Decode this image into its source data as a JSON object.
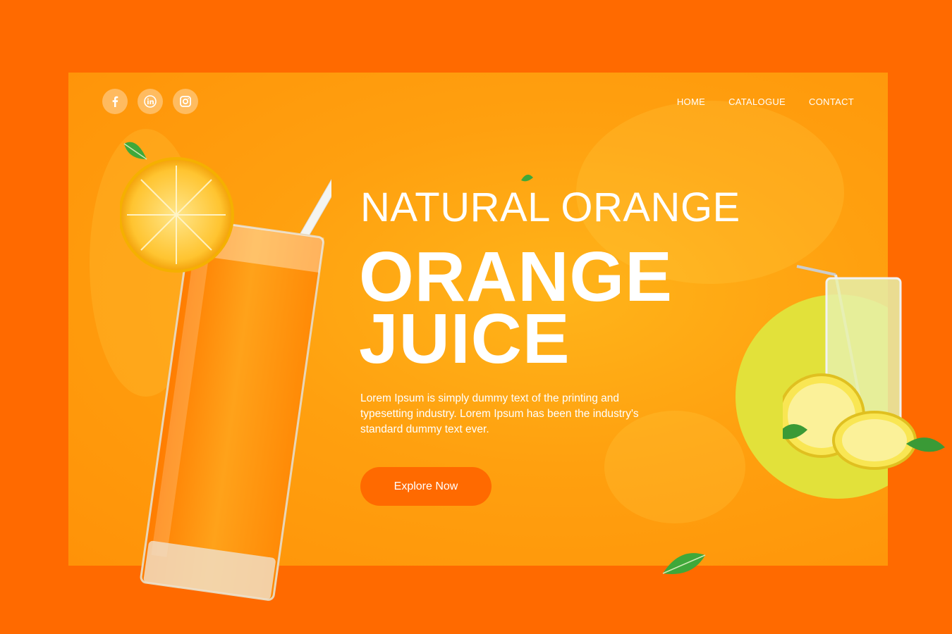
{
  "social": {
    "items": [
      {
        "name": "facebook",
        "glyph": "f"
      },
      {
        "name": "linkedin",
        "glyph": "in"
      },
      {
        "name": "instagram",
        "glyph": "◎"
      }
    ]
  },
  "nav": {
    "home": "HOME",
    "catalogue": "CATALOGUE",
    "contact": "CONTACT"
  },
  "hero": {
    "eyebrow": "NATURAL ORANGE",
    "title_line1": "ORANGE",
    "title_line2": "JUICE",
    "description": "Lorem Ipsum is simply dummy text of the printing and typesetting industry. Lorem Ipsum has been the industry's standard dummy text ever.",
    "cta_label": "Explore Now"
  },
  "colors": {
    "background": "#ff6a00",
    "hero_panel": "#ffa00f",
    "lime_circle": "#e2e13a",
    "leaf": "#3fa83a"
  }
}
